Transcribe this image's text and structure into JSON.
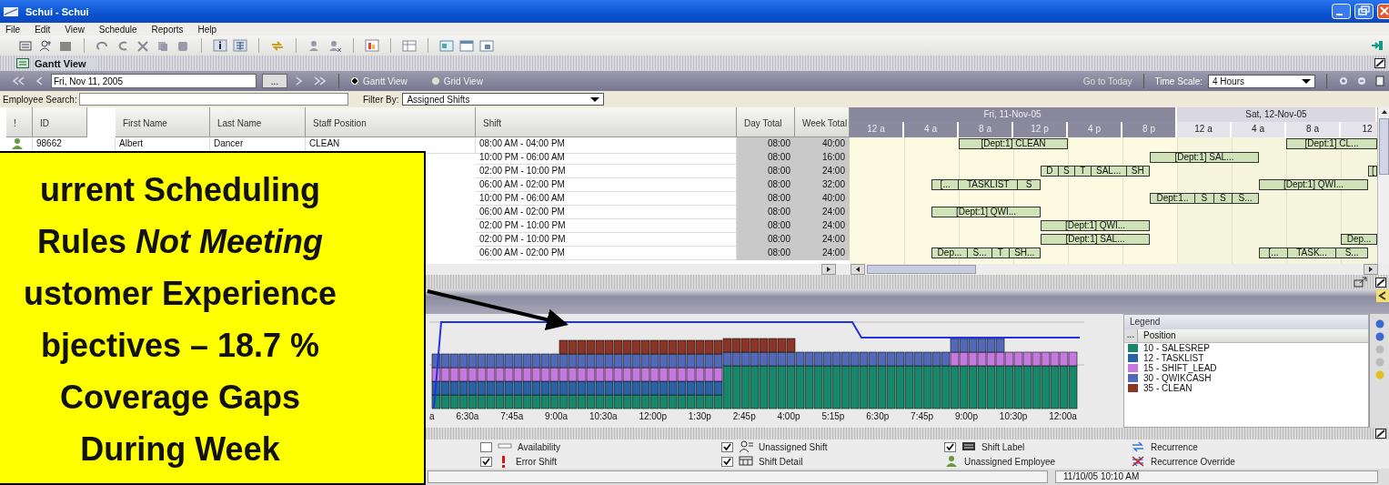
{
  "window": {
    "title": "Schui - Schui"
  },
  "menu": [
    "File",
    "Edit",
    "View",
    "Schedule",
    "Reports",
    "Help"
  ],
  "panel": {
    "title": "Gantt View"
  },
  "navigator": {
    "date": "Fri, Nov 11, 2005",
    "picker": "...",
    "views": [
      {
        "label": "Gantt View",
        "selected": true
      },
      {
        "label": "Grid View",
        "selected": false
      }
    ],
    "go_to_today": "Go to Today",
    "time_scale_label": "Time Scale:",
    "time_scale": "4 Hours"
  },
  "search": {
    "label": "Employee Search:",
    "filter_label": "Filter By:",
    "filter": "Assigned Shifts"
  },
  "table": {
    "columns": [
      "!",
      "ID",
      "First Name",
      "Last Name",
      "Staff Position",
      "Shift",
      "Day Total",
      "Week Total"
    ],
    "rows": [
      {
        "unassigned": true,
        "id": "98662",
        "first_name": "Albert",
        "last_name": "Dancer",
        "position": "CLEAN",
        "shift": "08:00 AM - 04:00 PM",
        "day_total": "08:00",
        "week_total": "40:00"
      },
      {
        "shift": "10:00 PM - 06:00 AM",
        "day_total": "08:00",
        "week_total": "16:00"
      },
      {
        "shift": "02:00 PM - 10:00 PM",
        "day_total": "08:00",
        "week_total": "24:00"
      },
      {
        "shift": "06:00 AM - 02:00 PM",
        "day_total": "08:00",
        "week_total": "32:00"
      },
      {
        "shift": "10:00 PM - 06:00 AM",
        "day_total": "08:00",
        "week_total": "40:00"
      },
      {
        "shift": "06:00 AM - 02:00 PM",
        "day_total": "08:00",
        "week_total": "24:00"
      },
      {
        "shift": "02:00 PM - 10:00 PM",
        "day_total": "08:00",
        "week_total": "24:00"
      },
      {
        "shift": "02:00 PM - 10:00 PM",
        "day_total": "08:00",
        "week_total": "24:00"
      },
      {
        "shift": "06:00 AM - 02:00 PM",
        "day_total": "08:00",
        "week_total": "24:00"
      }
    ]
  },
  "gantt": {
    "days": [
      {
        "label": "Fri, 11-Nov-05",
        "selected": true
      },
      {
        "label": "Sat, 12-Nov-05",
        "selected": false
      }
    ],
    "hours": [
      "12 a",
      "4 a",
      "8 a",
      "12 p",
      "4 p",
      "8 p",
      "12 a",
      "4 a",
      "8 a",
      "12"
    ],
    "rows": [
      {
        "bars": [
          {
            "kind": "day1",
            "segments": [
              "[Dept:1] CLEAN"
            ]
          },
          {
            "kind": "day2",
            "segments": [
              "[Dept:1] CL..."
            ]
          }
        ]
      },
      {
        "bars": [
          {
            "kind": "day1",
            "segments": [
              "[Dept:1] SAL..."
            ]
          }
        ]
      },
      {
        "bars": [
          {
            "kind": "day1",
            "segments": [
              "D",
              "S",
              "T",
              "SAL...",
              "SH"
            ]
          },
          {
            "kind": "day2",
            "segments": [
              "["
            ]
          }
        ]
      },
      {
        "bars": [
          {
            "kind": "day1",
            "segments": [
              "[...",
              "TASKLIST",
              "S"
            ]
          },
          {
            "kind": "day2",
            "segments": [
              "[Dept:1] QWI..."
            ]
          }
        ]
      },
      {
        "bars": [
          {
            "kind": "day1",
            "segments": [
              "Dept:1..",
              "S",
              "S",
              "S..."
            ]
          }
        ]
      },
      {
        "bars": [
          {
            "kind": "day1",
            "segments": [
              "[Dept:1] QWI..."
            ]
          }
        ]
      },
      {
        "bars": [
          {
            "kind": "day1",
            "segments": [
              "[Dept:1] QWI..."
            ]
          }
        ]
      },
      {
        "bars": [
          {
            "kind": "day1",
            "segments": [
              "[Dept:1] SAL..."
            ]
          },
          {
            "kind": "day2early",
            "segments": [
              "Dep..."
            ]
          }
        ]
      },
      {
        "bars": [
          {
            "kind": "day1",
            "segments": [
              "Dep...",
              "S...",
              "T",
              "SH..."
            ]
          },
          {
            "kind": "day2",
            "segments": [
              "[...",
              "TASK...",
              "S..."
            ]
          }
        ]
      }
    ]
  },
  "coverage": {
    "axis_labels": [
      "a",
      "6:30a",
      "7:45a",
      "9:00a",
      "10:30a",
      "12:00p",
      "1:30p",
      "2:45p",
      "4:00p",
      "5:15p",
      "6:30p",
      "7:45p",
      "9:00p",
      "10:30p",
      "12:00a"
    ],
    "legend_title": "Legend",
    "legend_button": "...",
    "legend_header": "Position",
    "positions": [
      {
        "label": "10 - SALESREP",
        "color": "#16876a"
      },
      {
        "label": "12 - TASKLIST",
        "color": "#2a62a8"
      },
      {
        "label": "15 - SHIFT_LEAD",
        "color": "#c478e0"
      },
      {
        "label": "30 - QWIKCASH",
        "color": "#5268b8"
      },
      {
        "label": "35 - CLEAN",
        "color": "#8c3426"
      }
    ]
  },
  "options": [
    {
      "kind": "checkbox",
      "label": "Availability",
      "checked": false
    },
    {
      "kind": "checkbox",
      "label": "Unassigned Shift",
      "checked": true
    },
    {
      "kind": "checkbox",
      "label": "Shift Label",
      "checked": true
    },
    {
      "kind": "plain",
      "label": "Recurrence"
    },
    {
      "kind": "checkbox",
      "label": "Error Shift",
      "checked": true
    },
    {
      "kind": "checkbox",
      "label": "Shift Detail",
      "checked": true
    },
    {
      "kind": "plain",
      "label": "Unassigned Employee"
    },
    {
      "kind": "plain",
      "label": "Recurrence Override"
    }
  ],
  "status_bar": {
    "time": "11/10/05 10:10 AM"
  },
  "callout": {
    "text": "urrent Scheduling\nRules *Not Meeting*\nustomer Experience\nbjectives – 18.7 %\nCoverage Gaps\nDuring Week"
  }
}
